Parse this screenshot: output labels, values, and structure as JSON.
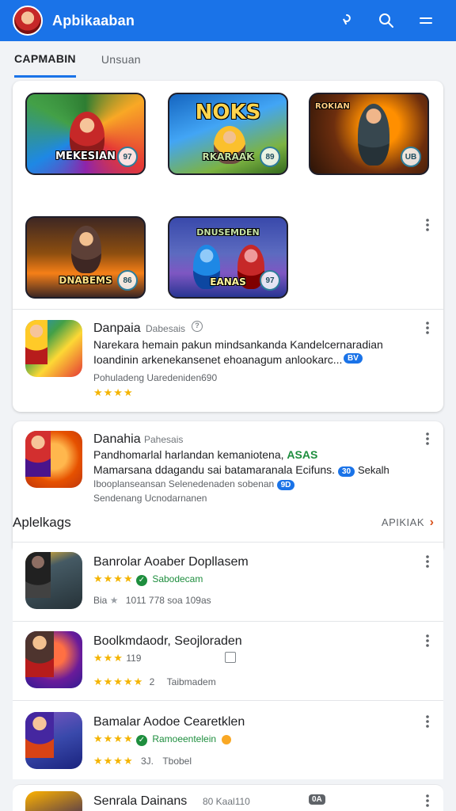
{
  "header": {
    "title": "Apbikaaban"
  },
  "tabs": [
    {
      "label": "CAPMABIN"
    },
    {
      "label": "Unsuan"
    }
  ],
  "featured": {
    "tiles": [
      {
        "title": "MEKESIAN",
        "badge": "97"
      },
      {
        "title": "NOKS",
        "subtitle": "RKARAAK",
        "badge": "89"
      },
      {
        "title": "ROKIAN",
        "badge": "UB"
      },
      {
        "title": "DNABEMS",
        "badge": "86"
      },
      {
        "title": "DNUSEMDEN",
        "subtitle": "EANAS",
        "badge": "97"
      }
    ],
    "promo": {
      "name": "Danpaia",
      "publisher": "Dabesais",
      "desc1": "Narekara hemain pakun mindsankanda Kandelcernaradian",
      "desc2": "Ioandinin arkenekansenet ehoanagum anlookarc...",
      "chip": "BV",
      "meta": "Pohuladeng Uaredeniden690",
      "stars": "★★★★"
    }
  },
  "card2": {
    "name": "Danahia",
    "publisher": "Pahesais",
    "desc1": "Pandhomarlal harlandan kemaniotena,",
    "desc1_green": "ASAS",
    "desc2": "Mamarsana ddagandu sai batamaranala Ecifuns.",
    "desc2_chip": "30",
    "desc2_tail": "Sekalh",
    "desc3": "Ibooplanseansan Selenedenaden sobenan",
    "desc3_chip": "9D",
    "meta": "Sendenang Ucnodarnanen"
  },
  "section": {
    "title": "Aplelkags",
    "link": "APIKIAK"
  },
  "apps": [
    {
      "name": "Banrolar Aoaber Dopllasem",
      "stars": "★★★★",
      "tag": "Sabodecam",
      "meta_prefix": "Bia",
      "meta": "1011 778 soa 109as"
    },
    {
      "name": "Boolkmdaodr, Seojloraden",
      "stars_inline": "★★★",
      "inline_num": "119",
      "stars": "★★★★★",
      "rank": "2",
      "meta": "Taibmadem"
    },
    {
      "name": "Bamalar Aodoe Cearetklen",
      "stars_inline": "★★★★",
      "tag": "Ramoeentelein",
      "stars": "★★★★",
      "rank": "3J.",
      "meta": "Tbobel"
    },
    {
      "name": "Senrala Dainans",
      "extra": "80 Kaal110",
      "chip": "0A"
    }
  ],
  "colors": {
    "brand": "#1a73e8",
    "star": "#f4b400",
    "green": "#1e8e3e",
    "accent": "#d9531e"
  }
}
